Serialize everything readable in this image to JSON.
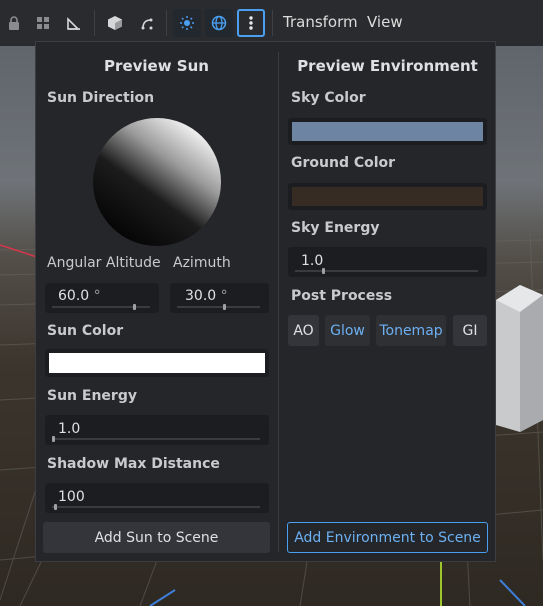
{
  "toolbar": {
    "icons": [
      "lock-icon",
      "grid-snap-icon",
      "ruler-icon",
      "cube-icon",
      "transform-icon",
      "sun-icon",
      "globe-icon",
      "more-vertical-icon"
    ],
    "menus": [
      "Transform",
      "View"
    ]
  },
  "preview_sun": {
    "title": "Preview Sun",
    "sun_direction_label": "Sun Direction",
    "angular_altitude_label": "Angular Altitude",
    "azimuth_label": "Azimuth",
    "angular_altitude_value": "60.0",
    "azimuth_value": "30.0",
    "degree_unit": "°",
    "angular_altitude_fraction": 0.83,
    "azimuth_fraction": 0.55,
    "sun_color_label": "Sun Color",
    "sun_color": "#ffffff",
    "sun_energy_label": "Sun Energy",
    "sun_energy_value": "1.0",
    "sun_energy_fraction": 0.0,
    "shadow_max_distance_label": "Shadow Max Distance",
    "shadow_max_distance_value": "100",
    "shadow_max_distance_fraction": 0.01,
    "add_button": "Add Sun to Scene"
  },
  "preview_environment": {
    "title": "Preview Environment",
    "sky_color_label": "Sky Color",
    "sky_color": "#6e84a3",
    "ground_color_label": "Ground Color",
    "ground_color": "#372c24",
    "sky_energy_label": "Sky Energy",
    "sky_energy_value": "1.0",
    "sky_energy_fraction": 0.15,
    "post_process_label": "Post Process",
    "post_process_buttons": [
      {
        "label": "AO",
        "active": false
      },
      {
        "label": "Glow",
        "active": true
      },
      {
        "label": "Tonemap",
        "active": true
      },
      {
        "label": "GI",
        "active": false
      }
    ],
    "add_button": "Add Environment to Scene"
  },
  "colors": {
    "accent": "#4a9ff0",
    "active_text": "#6cb0f2"
  }
}
